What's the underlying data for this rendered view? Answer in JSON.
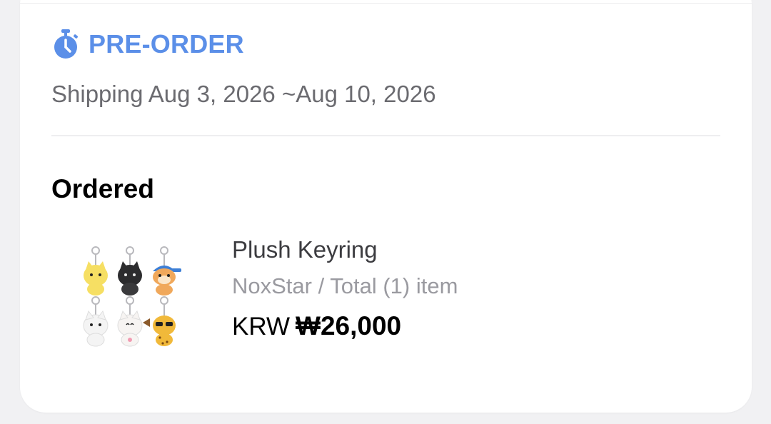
{
  "preorder": {
    "label": "PRE-ORDER",
    "icon": "stopwatch-icon",
    "color": "#5b8fe8",
    "shipping": "Shipping Aug 3, 2026 ~Aug 10, 2026"
  },
  "ordered": {
    "title": "Ordered",
    "product": {
      "name": "Plush Keyring",
      "meta": "NoxStar / Total (1) item",
      "currency": "KRW",
      "amount": "₩26,000",
      "image": "plush-keyring-thumbnail"
    }
  }
}
